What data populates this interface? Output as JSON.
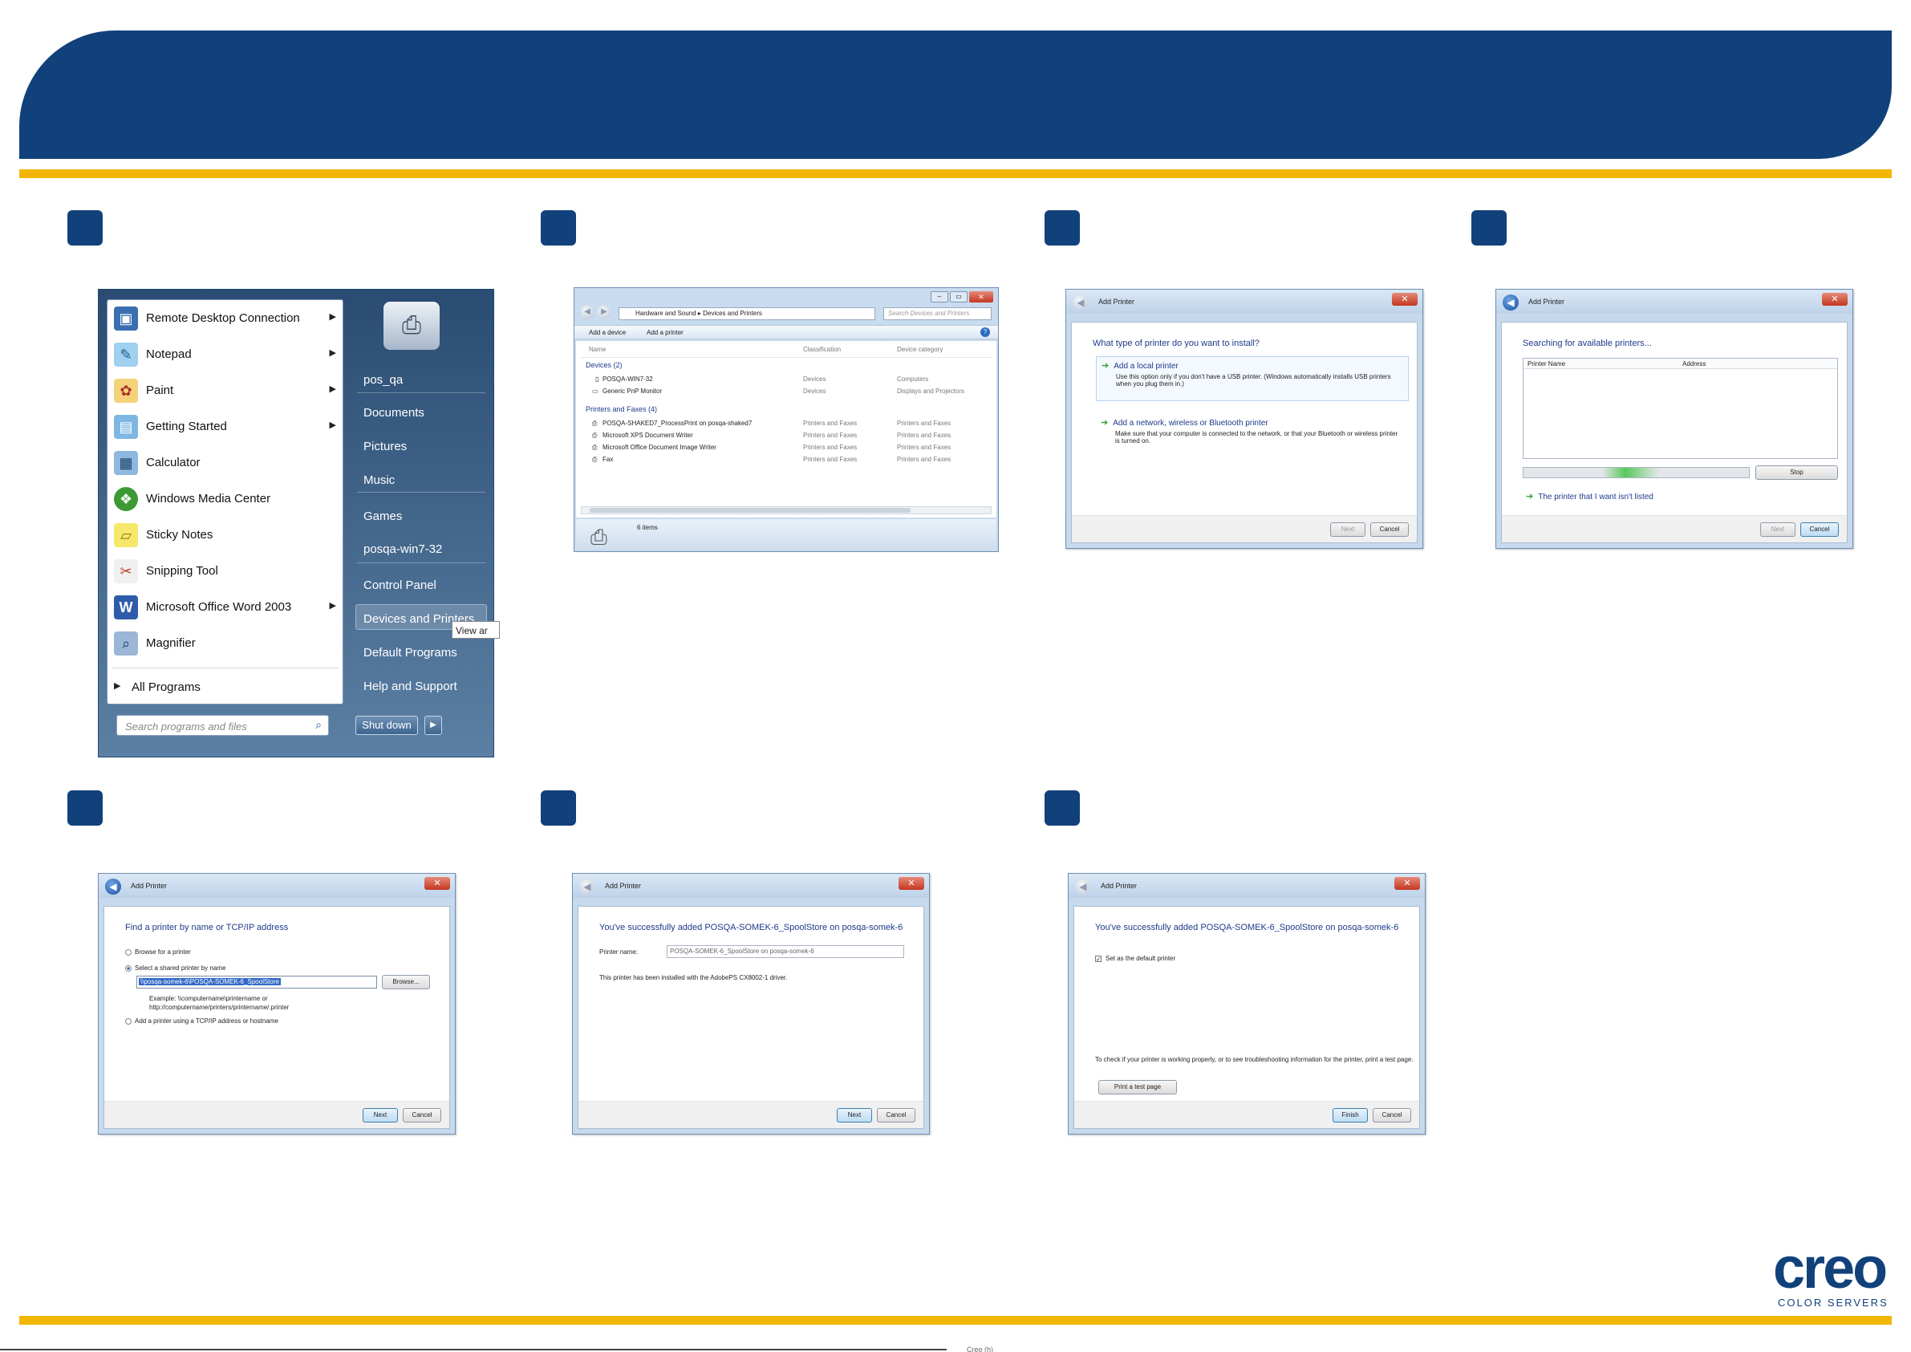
{
  "footer_mark": "Creo (h)",
  "logo": {
    "brand": "creo",
    "tagline": "COLOR SERVERS"
  },
  "start_menu": {
    "programs": [
      {
        "label": "Remote Desktop Connection",
        "icon": "remote-desktop-icon",
        "arrow": true
      },
      {
        "label": "Notepad",
        "icon": "notepad-icon",
        "arrow": true
      },
      {
        "label": "Paint",
        "icon": "paint-icon",
        "arrow": true
      },
      {
        "label": "Getting Started",
        "icon": "getting-started-icon",
        "arrow": true
      },
      {
        "label": "Calculator",
        "icon": "calculator-icon",
        "arrow": false
      },
      {
        "label": "Windows Media Center",
        "icon": "media-center-icon",
        "arrow": false
      },
      {
        "label": "Sticky Notes",
        "icon": "sticky-notes-icon",
        "arrow": false
      },
      {
        "label": "Snipping Tool",
        "icon": "snipping-tool-icon",
        "arrow": false
      },
      {
        "label": "Microsoft Office Word 2003",
        "icon": "word-icon",
        "arrow": true
      },
      {
        "label": "Magnifier",
        "icon": "magnifier-icon",
        "arrow": false
      }
    ],
    "all_programs": "All Programs",
    "search_placeholder": "Search programs and files",
    "right_items": [
      "pos_qa",
      "Documents",
      "Pictures",
      "Music",
      "Games",
      "posqa-win7-32",
      "Control Panel",
      "Devices and Printers",
      "Default Programs",
      "Help and Support"
    ],
    "shutdown": "Shut down",
    "tooltip": "View ar"
  },
  "explorer": {
    "breadcrumb": [
      "Hardware and Sound",
      "Devices and Printers"
    ],
    "search_placeholder": "Search Devices and Printers",
    "toolbar": [
      "Add a device",
      "Add a printer"
    ],
    "columns": [
      "Name",
      "Classification",
      "Device category"
    ],
    "groups": [
      {
        "title": "Devices (2)",
        "rows": [
          [
            "POSQA-WIN7-32",
            "Devices",
            "Computers"
          ],
          [
            "Generic PnP Monitor",
            "Devices",
            "Displays and Projectors"
          ]
        ]
      },
      {
        "title": "Printers and Faxes (4)",
        "rows": [
          [
            "POSQA-SHAKED7_ProcessPrint on posqa-shaked7",
            "Printers and Faxes",
            "Printers and Faxes"
          ],
          [
            "Microsoft XPS Document Writer",
            "Printers and Faxes",
            "Printers and Faxes"
          ],
          [
            "Microsoft Office Document Image Writer",
            "Printers and Faxes",
            "Printers and Faxes"
          ],
          [
            "Fax",
            "Printers and Faxes",
            "Printers and Faxes"
          ]
        ]
      }
    ],
    "status": "6 items"
  },
  "dialog_type": {
    "title": "Add Printer",
    "question": "What type of printer do you want to install?",
    "option1_title": "Add a local printer",
    "option1_desc": "Use this option only if you don't have a USB printer. (Windows automatically installs USB printers when you plug them in.)",
    "option2_title": "Add a network, wireless or Bluetooth printer",
    "option2_desc": "Make sure that your computer is connected to the network, or that your Bluetooth or wireless printer is turned on.",
    "next": "Next",
    "cancel": "Cancel"
  },
  "dialog_search": {
    "title": "Add Printer",
    "heading": "Searching for available printers...",
    "col_name": "Printer Name",
    "col_address": "Address",
    "stop": "Stop",
    "not_listed": "The printer that I want isn't listed",
    "next": "Next",
    "cancel": "Cancel"
  },
  "dialog_find": {
    "title": "Add Printer",
    "heading": "Find a printer by name or TCP/IP address",
    "opt_browse": "Browse for a printer",
    "opt_shared": "Select a shared printer by name",
    "shared_value": "\\\\posqa-somek-6\\POSQA-SOMEK-6_SpoolStore",
    "browse": "Browse...",
    "example1": "Example: \\\\computername\\printername or",
    "example2": "http://computername/printers/printername/.printer",
    "opt_tcp": "Add a printer using a TCP/IP address or hostname",
    "next": "Next",
    "cancel": "Cancel"
  },
  "dialog_added": {
    "title": "Add Printer",
    "heading": "You've successfully added POSQA-SOMEK-6_SpoolStore on posqa-somek-6",
    "name_label": "Printer name:",
    "name_value": "POSQA-SOMEK-6_SpoolStore on posqa-somek-6",
    "driver_note": "This printer has been installed with the AdobePS CX8002-1 driver.",
    "next": "Next",
    "cancel": "Cancel"
  },
  "dialog_finish": {
    "title": "Add Printer",
    "heading": "You've successfully added POSQA-SOMEK-6_SpoolStore on posqa-somek-6",
    "default_label": "Set as the default printer",
    "test_note": "To check if your printer is working properly, or to see troubleshooting information for the printer, print a test page.",
    "test_btn": "Print a test page",
    "finish": "Finish",
    "cancel": "Cancel"
  },
  "colors": {
    "brand_blue": "#11417a",
    "accent_yellow": "#f2b705"
  }
}
